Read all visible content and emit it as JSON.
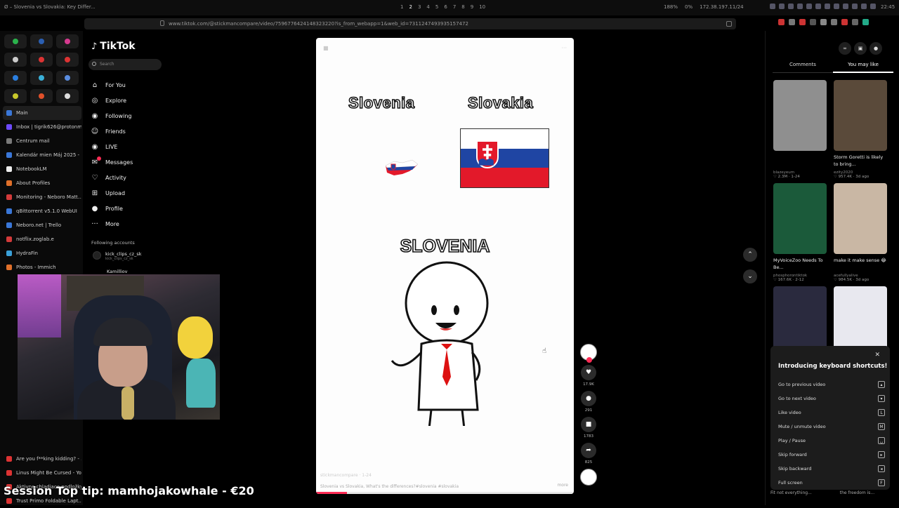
{
  "window": {
    "title": "Ø – Slovenia vs Slovakia: Key Differ...",
    "workspaces": [
      "1",
      "2",
      "3",
      "4",
      "5",
      "6",
      "7",
      "8",
      "9",
      "10"
    ],
    "active_workspace": "2",
    "stats": [
      "188%",
      "0%",
      "172.38.197.11/24"
    ],
    "clock": "22:45"
  },
  "browser": {
    "url": "www.tiktok.com/@stickmancompare/video/7596776424148323220?is_from_webapp=1&web_id=7311247493935157472"
  },
  "sidebar": {
    "tabs": [
      {
        "label": "Main",
        "color": "#3a77d8"
      },
      {
        "label": "Inbox | tigrik626@protonm...",
        "color": "#6d4aff"
      },
      {
        "label": "Centrum mail",
        "color": "#7a7a7a"
      },
      {
        "label": "Kalendár mien Máj 2025 - ...",
        "color": "#3a77d8"
      },
      {
        "label": "NotebookLM",
        "color": "#eeeeee"
      },
      {
        "label": "About Profiles",
        "color": "#e0702a"
      },
      {
        "label": "Monitoring - Neboro Matt...",
        "color": "#d33a3a"
      },
      {
        "label": "qBittorrent v5.1.0 WebUI",
        "color": "#3a77d8"
      },
      {
        "label": "Neboro.net | Trello",
        "color": "#3a77d8"
      },
      {
        "label": "notflix.zoglab.e",
        "color": "#d33a3a"
      },
      {
        "label": "HydraFin",
        "color": "#3aa0d8"
      },
      {
        "label": "Photos - Immich",
        "color": "#e0702a"
      }
    ],
    "bottom_tabs": [
      {
        "label": "Are you f**king kidding? - ..."
      },
      {
        "label": "Linus Might Be Cursed - Yo..."
      },
      {
        "label": "Aktivne chladiace podložky..."
      },
      {
        "label": "Trust Primo Foldable Lapt..."
      }
    ]
  },
  "tiktok": {
    "logo": "TikTok",
    "search_placeholder": "Search",
    "nav": [
      {
        "label": "For You",
        "icon": "home-icon",
        "glyph": "⌂"
      },
      {
        "label": "Explore",
        "icon": "compass-icon",
        "glyph": "◎"
      },
      {
        "label": "Following",
        "icon": "following-icon",
        "glyph": "◉"
      },
      {
        "label": "Friends",
        "icon": "friends-icon",
        "glyph": "☺"
      },
      {
        "label": "LIVE",
        "icon": "live-icon",
        "glyph": "◉"
      },
      {
        "label": "Messages",
        "icon": "messages-icon",
        "glyph": "✉"
      },
      {
        "label": "Activity",
        "icon": "activity-icon",
        "glyph": "♡"
      },
      {
        "label": "Upload",
        "icon": "upload-icon",
        "glyph": "⊞"
      },
      {
        "label": "Profile",
        "icon": "profile-icon",
        "glyph": "●"
      },
      {
        "label": "More",
        "icon": "more-icon",
        "glyph": "···"
      }
    ],
    "following_title": "Following accounts",
    "following": [
      {
        "name": "kick_clips_cz_sk",
        "handle": "kick_clips_cz_sk"
      },
      {
        "name": "Kamilliov"
      }
    ]
  },
  "stream": {
    "session_tip": "Session Top tip: mamhojakowhale - €20"
  },
  "video": {
    "left_country": "Slovenia",
    "right_country": "Slovakia",
    "big_title": "SLOVENIA",
    "author": "stickmancompare · 1-24",
    "caption": "Slovenia vs Slovakia, What's the differences?#slovenia #slovakia",
    "more": "more",
    "progress": 0.12,
    "actions": [
      {
        "name": "like",
        "glyph": "♥",
        "count": "17.9K"
      },
      {
        "name": "comment",
        "glyph": "●",
        "count": "291"
      },
      {
        "name": "bookmark",
        "glyph": "■",
        "count": "1783"
      },
      {
        "name": "share",
        "glyph": "➦",
        "count": "825"
      }
    ]
  },
  "right_panel": {
    "tabs": [
      "Comments",
      "You may like"
    ],
    "active_tab": "You may like",
    "thumbs": [
      {
        "title": "",
        "user": "blazeyeum",
        "meta": "♡ 2.3M · 1-24",
        "bg": "#8f8f8f"
      },
      {
        "title": "Storm Goretti is likely to bring...",
        "user": "ezity2020",
        "meta": "♡ 957.4K · 3d ago",
        "bg": "#5a4a3a"
      },
      {
        "title": "MyVoiceZoo Needs To Be...",
        "user": "phosphorontiktok",
        "meta": "♡ 167.6K · 2-12",
        "bg": "#1b5a3a"
      },
      {
        "title": "make it make sense 😂",
        "user": "acefullyalive",
        "meta": "♡ 984.5K · 3d ago",
        "bg": "#c9b7a4"
      },
      {
        "title": "",
        "user": "",
        "meta": "",
        "bg": "#2a2a3e"
      },
      {
        "title": "",
        "user": "",
        "meta": "",
        "bg": "#e8e8ef"
      }
    ]
  },
  "shortcuts": {
    "title": "Introducing keyboard shortcuts!",
    "rows": [
      {
        "label": "Go to previous video",
        "key": "▴"
      },
      {
        "label": "Go to next video",
        "key": "▾"
      },
      {
        "label": "Like video",
        "key": "L"
      },
      {
        "label": "Mute / unmute video",
        "key": "M"
      },
      {
        "label": "Play / Pause",
        "key": "␣"
      },
      {
        "label": "Skip forward",
        "key": "▸"
      },
      {
        "label": "Skip backward",
        "key": "◂"
      },
      {
        "label": "Full screen",
        "key": "F"
      }
    ],
    "bottom_left": "Fit not everything...",
    "bottom_right": "the freedom is..."
  }
}
